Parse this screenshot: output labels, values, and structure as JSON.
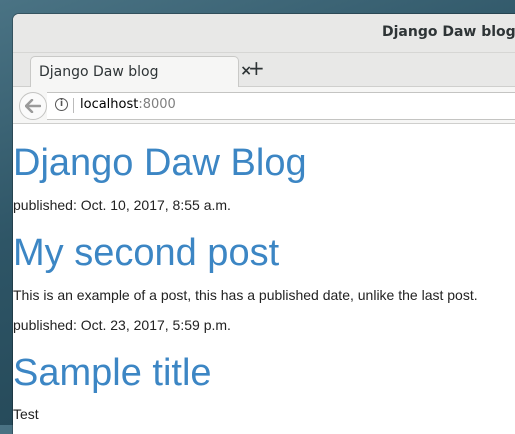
{
  "window": {
    "title": "Django Daw blog - M"
  },
  "tabs": [
    {
      "label": "Django Daw blog",
      "close": "×"
    }
  ],
  "new_tab_label": "+",
  "address": {
    "host": "localhost",
    "port": ":8000"
  },
  "blog": {
    "title": "Django Daw Blog",
    "published": "published: Oct. 10, 2017, 8:55 a.m."
  },
  "posts": [
    {
      "title": "My second post",
      "text": "This is an example of a post, this has a published date, unlike the last post.",
      "published": "published: Oct. 23, 2017, 5:59 p.m."
    },
    {
      "title": "Sample title",
      "text": "Test"
    }
  ],
  "colors": {
    "link_blue": "#3c86c4",
    "desktop": "#2e5566"
  }
}
